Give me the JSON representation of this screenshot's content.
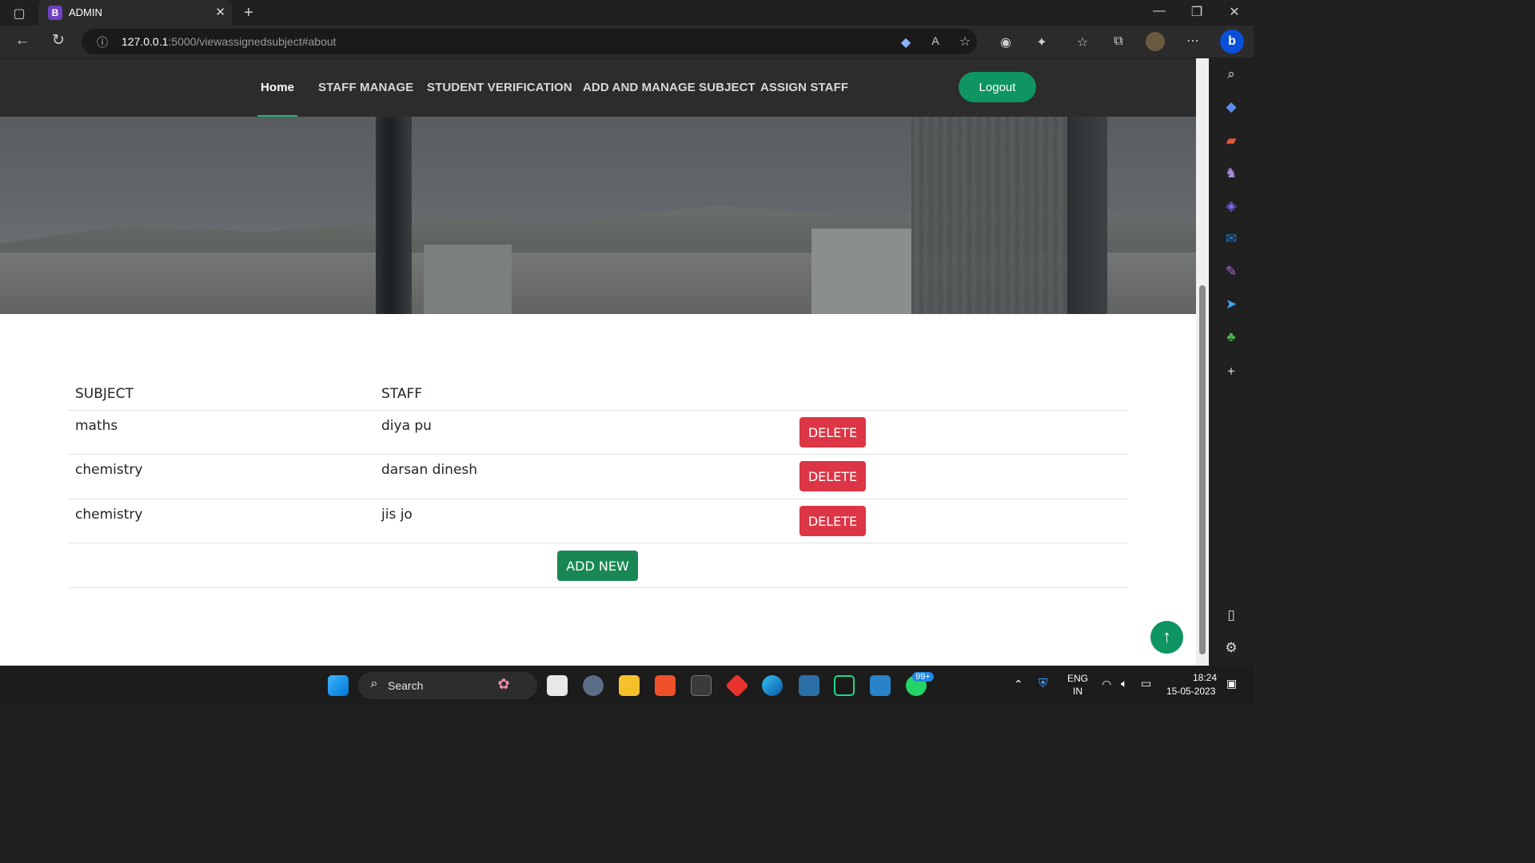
{
  "browser": {
    "tab_title": "ADMIN",
    "tab_favicon": "B",
    "url_host": "127.0.0.1",
    "url_rest": ":5000/viewassignedsubject#about"
  },
  "nav": {
    "links": [
      "Home",
      "STAFF MANAGE",
      "STUDENT VERIFICATION",
      "ADD AND MANAGE SUBJECT",
      "ASSIGN STAFF"
    ],
    "logout": "Logout"
  },
  "table": {
    "headers": [
      "SUBJECT",
      "STAFF"
    ],
    "rows": [
      {
        "subject": "maths",
        "staff": "diya pu",
        "action": "DELETE"
      },
      {
        "subject": "chemistry",
        "staff": "darsan dinesh",
        "action": "DELETE"
      },
      {
        "subject": "chemistry",
        "staff": "jis jo",
        "action": "DELETE"
      }
    ],
    "add_button": "ADD NEW"
  },
  "taskbar": {
    "search_label": "Search",
    "language_top": "ENG",
    "language_bottom": "IN",
    "time": "18:24",
    "date": "15-05-2023",
    "whatsapp_badge": "99+"
  },
  "colors": {
    "nav_bg": "#2c2c2c",
    "accent_green": "#0e9561",
    "delete_red": "#dc3545",
    "add_green": "#198754"
  }
}
